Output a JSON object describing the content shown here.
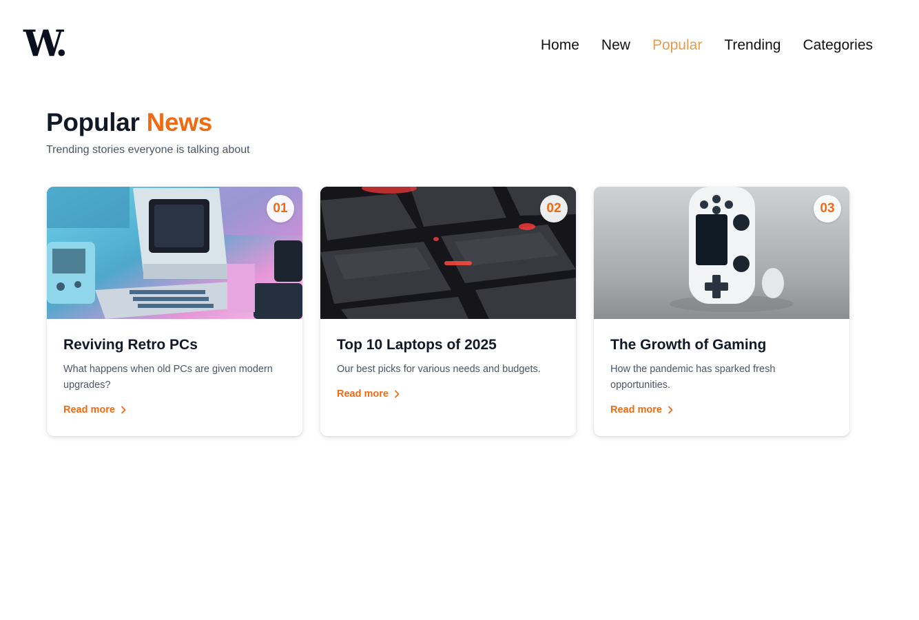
{
  "brand": {
    "logo_text": "W."
  },
  "nav": {
    "items": [
      {
        "label": "Home",
        "active": false
      },
      {
        "label": "New",
        "active": false
      },
      {
        "label": "Popular",
        "active": true
      },
      {
        "label": "Trending",
        "active": false
      },
      {
        "label": "Categories",
        "active": false
      }
    ]
  },
  "section": {
    "title_main": "Popular",
    "title_accent": "News",
    "subtitle": "Trending stories everyone is talking about"
  },
  "cards": [
    {
      "rank": "01",
      "title": "Reviving Retro PCs",
      "description": "What happens when old PCs are given modern upgrades?",
      "link_label": "Read more",
      "image": "retro-computers-image"
    },
    {
      "rank": "02",
      "title": "Top 10 Laptops of 2025",
      "description": "Our best picks for various needs and budgets.",
      "link_label": "Read more",
      "image": "keyboard-closeup-image"
    },
    {
      "rank": "03",
      "title": "The Growth of Gaming",
      "description": "How the pandemic has sparked fresh opportunities.",
      "link_label": "Read more",
      "image": "game-controller-image"
    }
  ],
  "colors": {
    "accent": "#f06a12",
    "nav_active": "#e39b4f",
    "heading": "#111827",
    "muted_text": "#4b5563"
  }
}
